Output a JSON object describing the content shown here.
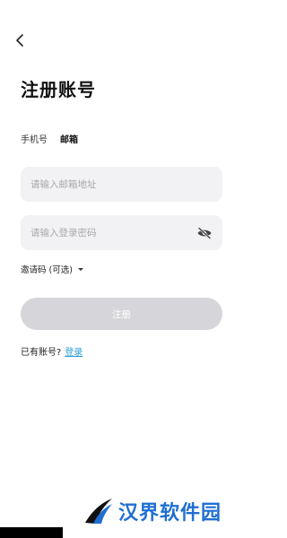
{
  "title": "注册账号",
  "tabs": [
    {
      "label": "手机号",
      "active": false
    },
    {
      "label": "邮箱",
      "active": true
    }
  ],
  "email": {
    "placeholder": "请输入邮箱地址",
    "value": ""
  },
  "password": {
    "placeholder": "请输入登录密码",
    "value": ""
  },
  "invite": {
    "label": "邀请码 (可选)"
  },
  "register_button": {
    "label": "注册"
  },
  "login_prompt": {
    "text": "已有账号?",
    "link": "登录"
  },
  "watermark": {
    "text": "汉界软件园"
  },
  "colors": {
    "accent": "#2a9fd6",
    "button_disabled": "#d6d6da",
    "field_bg": "#f2f2f4",
    "watermark": "#1f6fd1"
  },
  "icons": {
    "back": "chevron-left-icon",
    "password_toggle": "eye-off-icon",
    "invite_toggle": "caret-down-icon"
  }
}
